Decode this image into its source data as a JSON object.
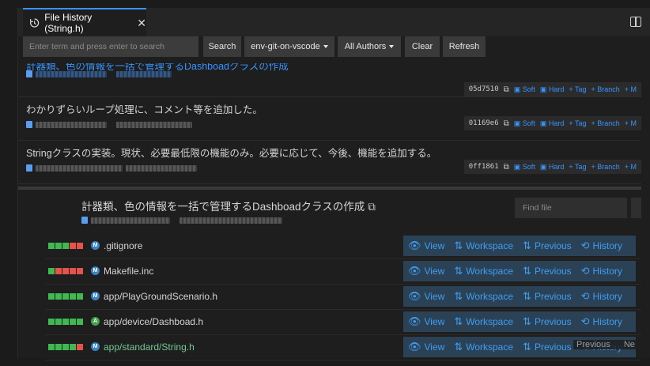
{
  "tab": {
    "title": "File History (String.h)",
    "close": "✕"
  },
  "toolbar": {
    "search_placeholder": "Enter term and press enter to search",
    "search_label": "Search",
    "branch_label": "env-git-on-vscode",
    "authors_label": "All Authors",
    "clear_label": "Clear",
    "refresh_label": "Refresh"
  },
  "commits": [
    {
      "message": "計器類、色の情報を一括で管理するDashboadクラスの作成",
      "hash": "05d7510"
    },
    {
      "message": "わかりずらいループ処理に、コメント等を追加した。",
      "hash": "01169e6"
    },
    {
      "message": "Stringクラスの実装。現状、必要最低限の機能のみ。必要に応じて、今後、機能を追加する。",
      "hash": "0ff1861"
    }
  ],
  "commit_actions": {
    "soft": "Soft",
    "hard": "Hard",
    "tag": "+ Tag",
    "branch": "+ Branch",
    "more": "+ M"
  },
  "details": {
    "title": "計器類、色の情報を一括で管理するDashboadクラスの作成",
    "find_placeholder": "Find file"
  },
  "files": [
    {
      "name": ".gitignore",
      "status": "M",
      "bars": [
        "g",
        "g",
        "g",
        "r",
        "r"
      ]
    },
    {
      "name": "Makefile.inc",
      "status": "M",
      "bars": [
        "g",
        "r",
        "r",
        "r",
        "r"
      ]
    },
    {
      "name": "app/PlayGroundScenario.h",
      "status": "M",
      "bars": [
        "g",
        "g",
        "g",
        "g",
        "g"
      ]
    },
    {
      "name": "app/device/Dashboad.h",
      "status": "A",
      "bars": [
        "g",
        "g",
        "g",
        "g",
        "g"
      ]
    },
    {
      "name": "app/standard/String.h",
      "status": "M",
      "bars": [
        "g",
        "g",
        "g",
        "g",
        "r"
      ]
    }
  ],
  "file_actions": {
    "view": "View",
    "workspace": "Workspace",
    "previous": "Previous",
    "history": "History"
  },
  "pager": {
    "previous": "Previous",
    "next": "Ne"
  },
  "colors": {
    "accent": "#3794ff",
    "added": "#3fb950",
    "deleted": "#e5534b"
  }
}
